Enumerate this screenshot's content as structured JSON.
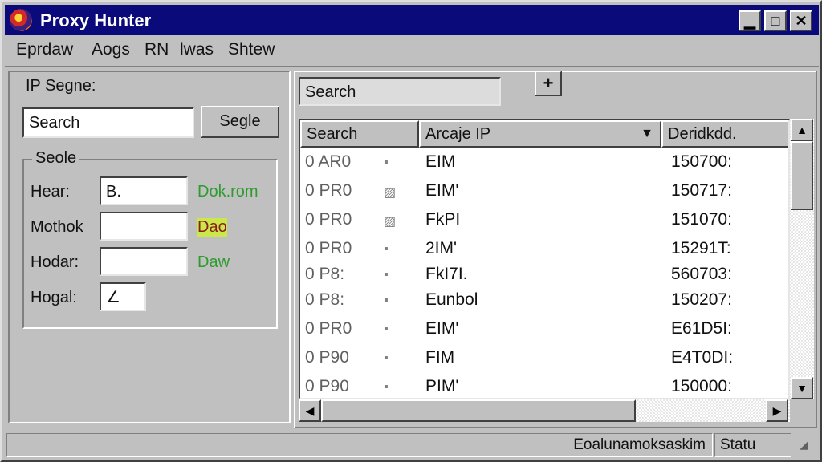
{
  "window": {
    "title": "Proxy Hunter"
  },
  "menu": [
    "Eprdaw",
    "Aogs",
    "RN",
    "lwas",
    "Shtew"
  ],
  "left": {
    "group_title": "IP Segne:",
    "search_value": "Search",
    "search_button": "Segle",
    "sub_group_title": "Seole",
    "fields": [
      {
        "label": "Hear:",
        "value": "B.",
        "note": "Dok.rom"
      },
      {
        "label": "Mothok",
        "value": "",
        "note": "Dao"
      },
      {
        "label": "Hodar:",
        "value": "",
        "note": "Daw"
      },
      {
        "label": "Hogal:",
        "value": "∠"
      }
    ]
  },
  "right": {
    "search_value": "Search",
    "add_button": "+",
    "columns": [
      "Search",
      "Arcaje IP",
      "Deridkdd."
    ],
    "rows": [
      {
        "c1": "0 AR0",
        "c2": "▪",
        "c3": "EIM",
        "c4": "150700:"
      },
      {
        "c1": "0 PR0",
        "c2": "▨",
        "c3": "EIM'",
        "c4": "150717:"
      },
      {
        "c1": "0 PR0",
        "c2": "▨",
        "c3": "FkPI",
        "c4": "151070:"
      },
      {
        "c1": "0 PR0",
        "c2": "▪",
        "c3": "2IM'",
        "c4": "15291T:"
      },
      {
        "c1": "0 P8:",
        "c2": "▪",
        "c3": "FkI7I.",
        "c4": "560703:"
      },
      {
        "c1": "0 P8:",
        "c2": "▪",
        "c3": "Eunbol",
        "c4": "150207:"
      },
      {
        "c1": "0 PR0",
        "c2": "▪",
        "c3": "EIM'",
        "c4": "E61D5I:"
      },
      {
        "c1": "0 P90",
        "c2": "▪",
        "c3": "FIM",
        "c4": "E4T0DI:"
      },
      {
        "c1": "0 P90",
        "c2": "▪",
        "c3": "PIM'",
        "c4": "150000:"
      }
    ]
  },
  "status": {
    "left": "Eoalunamoksaskim",
    "right": "Statu"
  },
  "icons": {
    "app": "proxy-hunter-logo",
    "minimize": "minimize-icon",
    "maximize": "maximize-icon",
    "close": "close-icon"
  }
}
